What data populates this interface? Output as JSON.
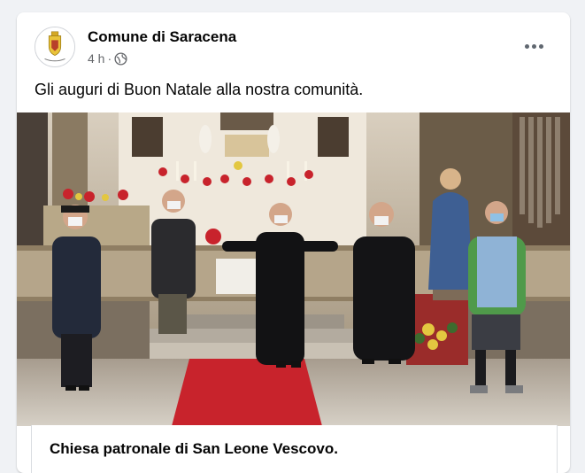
{
  "post": {
    "page_name": "Comune di Saracena",
    "time": "4 h",
    "separator": "·",
    "audience_icon": "globe-icon",
    "text": "Gli auguri di Buon Natale alla nostra comunità.",
    "more_icon": "more-options-icon"
  },
  "media": {
    "description_icon": "church-group-photo"
  },
  "link": {
    "title": "Chiesa patronale di San Leone Vescovo."
  },
  "colors": {
    "background": "#f0f2f5",
    "card": "#ffffff",
    "secondary_text": "#65676b",
    "carpet": "#c8232c"
  }
}
